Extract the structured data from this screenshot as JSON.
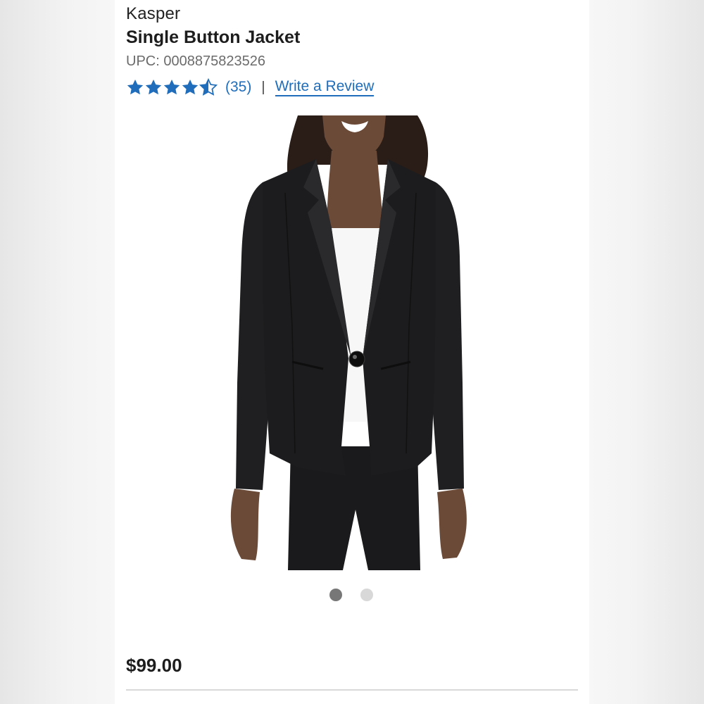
{
  "product": {
    "brand": "Kasper",
    "title": "Single Button Jacket",
    "upc": "UPC: 0008875823526",
    "rating": 4.5,
    "rating_max": 5,
    "review_count": "(35)",
    "separator": "|",
    "write_review_label": "Write a Review",
    "price": "$99.00"
  },
  "gallery": {
    "image_alt": "Woman wearing a black single button blazer over a white top",
    "active_index": 0,
    "total_images": 2
  },
  "colors": {
    "star": "#1f6dbb",
    "link": "#1f6dbb",
    "jacket": "#1c1c1e",
    "dot_active": "#777777",
    "dot_inactive": "#d8d8d8"
  }
}
